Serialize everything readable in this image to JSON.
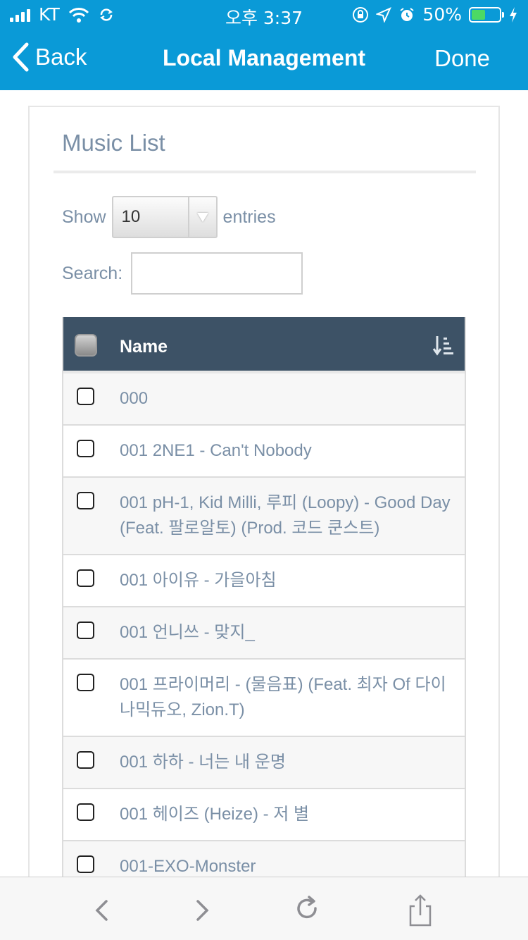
{
  "status_bar": {
    "carrier": "KT",
    "time": "오후 3:37",
    "battery_percent": "50%",
    "battery_level": 0.5,
    "icons": [
      "signal-icon",
      "wifi-icon",
      "sync-icon",
      "orientation-lock-icon",
      "location-icon",
      "alarm-icon",
      "battery-icon",
      "charging-icon"
    ]
  },
  "nav": {
    "back_label": "Back",
    "title": "Local Management",
    "done_label": "Done"
  },
  "panel": {
    "title": "Music List",
    "show_label": "Show",
    "page_size": "10",
    "entries_label": "entries",
    "search_label": "Search:",
    "search_value": ""
  },
  "table": {
    "column_name": "Name",
    "rows": [
      "000",
      "001 2NE1 - Can't Nobody",
      "001 pH-1, Kid Milli, 루피 (Loopy) - Good Day (Feat. 팔로알토) (Prod. 코드 쿤스트)",
      "001 아이유 - 가을아침",
      "001 언니쓰 - 맞지_",
      "001 프라이머리 - (물음표) (Feat. 최자 Of 다이나믹듀오, Zion.T)",
      "001 하하 - 너는 내 운명",
      "001 헤이즈 (Heize) - 저 별",
      "001-EXO-Monster"
    ]
  },
  "colors": {
    "accent": "#0a9ad7",
    "table_header": "#3d5266",
    "text_muted": "#7a8fa6"
  },
  "toolbar": {
    "icons": [
      "back-arrow-icon",
      "forward-arrow-icon",
      "reload-icon",
      "share-icon"
    ]
  }
}
